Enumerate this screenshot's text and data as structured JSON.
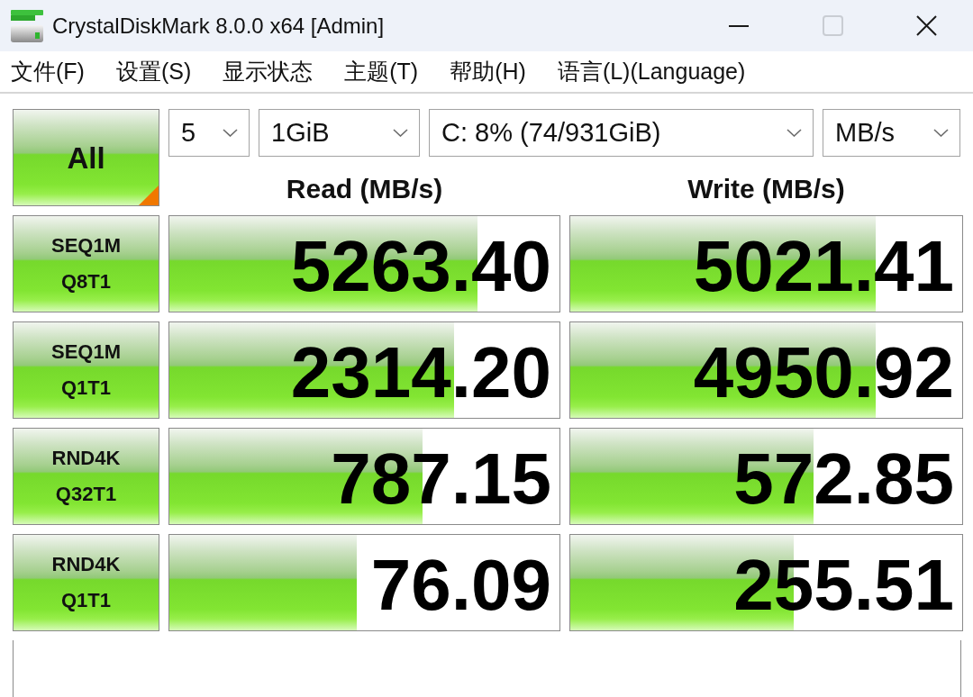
{
  "window": {
    "title": "CrystalDiskMark 8.0.0 x64 [Admin]",
    "controls": [
      {
        "kind": "minimize",
        "disabled": false
      },
      {
        "kind": "maximize",
        "disabled": true
      },
      {
        "kind": "close",
        "disabled": false
      }
    ]
  },
  "menu": [
    "文件(F)",
    "设置(S)",
    "显示状态",
    "主题(T)",
    "帮助(H)",
    "语言(L)(Language)"
  ],
  "all_button": "All",
  "selectors": [
    "5",
    "1GiB",
    "C: 8% (74/931GiB)",
    "MB/s"
  ],
  "columns": [
    "Read (MB/s)",
    "Write (MB/s)"
  ],
  "tests": [
    {
      "name": "SEQ1M",
      "params": "Q8T1",
      "read": {
        "value": "5263.40",
        "level": 0.79
      },
      "write": {
        "value": "5021.41",
        "level": 0.78
      }
    },
    {
      "name": "SEQ1M",
      "params": "Q1T1",
      "read": {
        "value": "2314.20",
        "level": 0.73
      },
      "write": {
        "value": "4950.92",
        "level": 0.78
      }
    },
    {
      "name": "RND4K",
      "params": "Q32T1",
      "read": {
        "value": "787.15",
        "level": 0.65
      },
      "write": {
        "value": "572.85",
        "level": 0.62
      }
    },
    {
      "name": "RND4K",
      "params": "Q1T1",
      "read": {
        "value": "76.09",
        "level": 0.48
      },
      "write": {
        "value": "255.51",
        "level": 0.57
      }
    }
  ]
}
